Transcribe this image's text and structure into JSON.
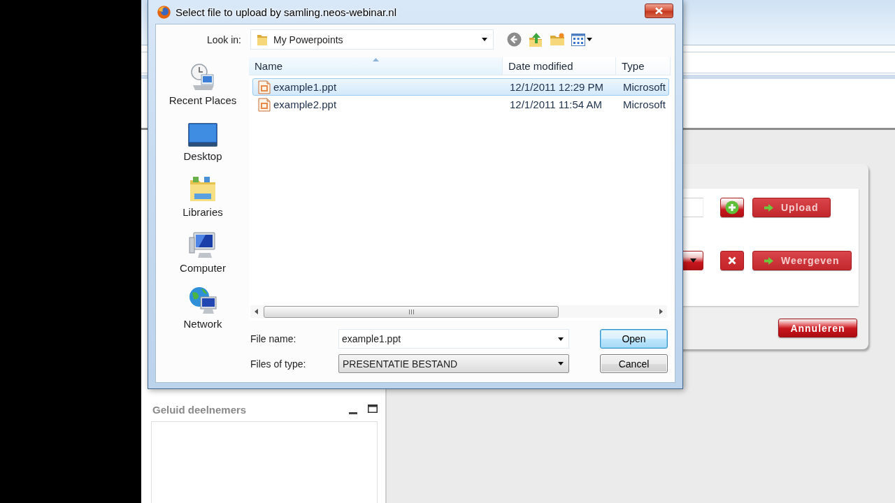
{
  "dialog": {
    "title": "Select file to upload by samling.neos-webinar.nl",
    "look_in": {
      "label": "Look in:",
      "value": "My Powerpoints"
    },
    "places": [
      {
        "label": "Recent Places",
        "kind": "recent"
      },
      {
        "label": "Desktop",
        "kind": "desktop"
      },
      {
        "label": "Libraries",
        "kind": "libraries"
      },
      {
        "label": "Computer",
        "kind": "computer"
      },
      {
        "label": "Network",
        "kind": "network"
      }
    ],
    "file_list": {
      "columns": [
        {
          "label": "Name",
          "sorted": true
        },
        {
          "label": "Date modified",
          "sorted": false
        },
        {
          "label": "Type",
          "sorted": false
        }
      ],
      "rows": [
        {
          "name": "example1.ppt",
          "date_modified": "12/1/2011 12:29 PM",
          "type": "Microsoft",
          "selected": true
        },
        {
          "name": "example2.ppt",
          "date_modified": "12/1/2011 11:54 AM",
          "type": "Microsoft",
          "selected": false
        }
      ]
    },
    "file_name": {
      "label": "File name:",
      "value": "example1.ppt"
    },
    "files_of_type": {
      "label": "Files of type:",
      "value": "PRESENTATIE BESTAND"
    },
    "buttons": [
      {
        "label": "Open",
        "focused": true
      },
      {
        "label": "Cancel",
        "focused": false
      }
    ]
  },
  "web_page": {
    "upload_panel": {
      "rows": [
        {
          "kind": "file",
          "button": "Upload"
        },
        {
          "kind": "select",
          "button": "Weergeven"
        }
      ],
      "cancel_button": "Annuleren"
    },
    "sound_panel": {
      "title": "Geluid deelnemers"
    }
  }
}
